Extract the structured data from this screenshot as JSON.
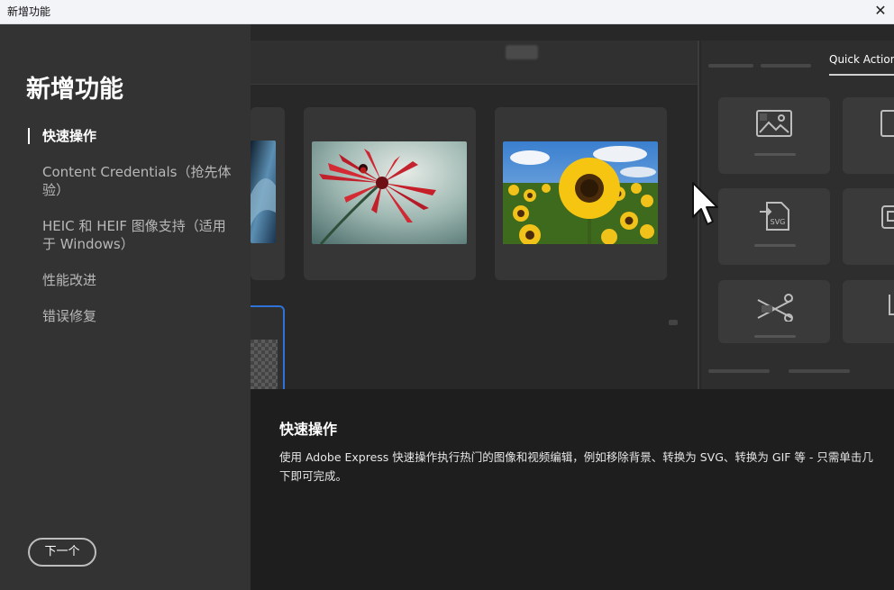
{
  "window": {
    "title": "新增功能",
    "close_glyph": "✕"
  },
  "sidebar": {
    "heading": "新增功能",
    "items": [
      {
        "label": "快速操作",
        "active": true
      },
      {
        "label": "Content Credentials（抢先体验）",
        "active": false
      },
      {
        "label": "HEIC 和 HEIF 图像支持（适用于 Windows）",
        "active": false
      },
      {
        "label": "性能改进",
        "active": false
      },
      {
        "label": "错误修复",
        "active": false
      }
    ],
    "next_button": "下一个"
  },
  "preview": {
    "quick_actions_tab": "Quick Action",
    "tile_icons": [
      "image-icon",
      "image-icon",
      "svg-convert-icon",
      "gif-icon",
      "remove-background-icon",
      "crop-icon"
    ],
    "photos": [
      "red-flower-photo",
      "sunflower-field-photo",
      "blue-abstract-photo"
    ]
  },
  "description": {
    "title": "快速操作",
    "body": "使用 Adobe Express 快速操作执行热门的图像和视频编辑，例如移除背景、转换为 SVG、转换为 GIF 等 - 只需单击几下即可完成。"
  },
  "colors": {
    "accent": "#2f73d9",
    "sidebar_bg": "#333333",
    "desc_bg": "#1e1e1e"
  }
}
